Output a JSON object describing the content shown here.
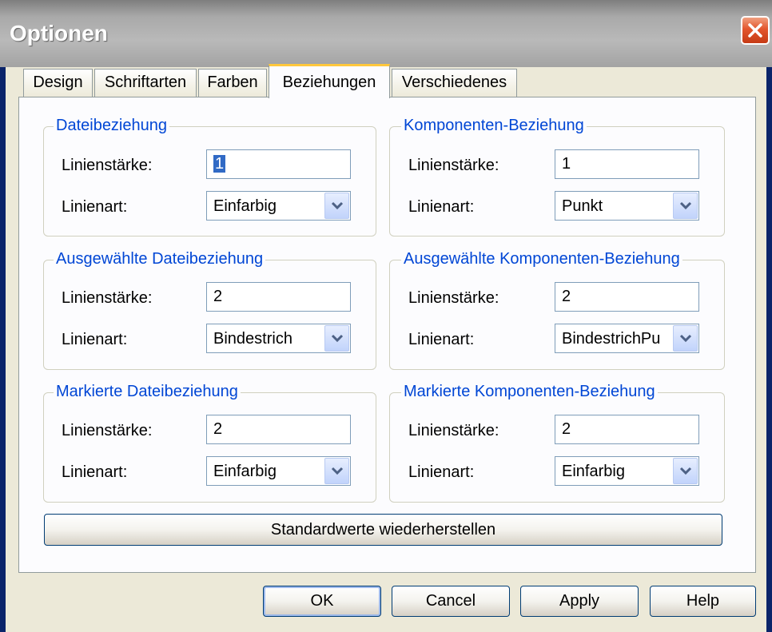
{
  "window": {
    "title": "Optionen"
  },
  "tabs": [
    {
      "label": "Design"
    },
    {
      "label": "Schriftarten"
    },
    {
      "label": "Farben"
    },
    {
      "label": "Beziehungen"
    },
    {
      "label": "Verschiedenes"
    }
  ],
  "active_tab": "Beziehungen",
  "groups": [
    {
      "title": "Dateibeziehung",
      "width_label": "Linienstärke:",
      "width_value": "1",
      "style_label": "Linienart:",
      "style_value": "Einfarbig"
    },
    {
      "title": "Komponenten-Beziehung",
      "width_label": "Linienstärke:",
      "width_value": "1",
      "style_label": "Linienart:",
      "style_value": "Punkt"
    },
    {
      "title": "Ausgewählte Dateibeziehung",
      "width_label": "Linienstärke:",
      "width_value": "2",
      "style_label": "Linienart:",
      "style_value": "Bindestrich"
    },
    {
      "title": "Ausgewählte Komponenten-Beziehung",
      "width_label": "Linienstärke:",
      "width_value": "2",
      "style_label": "Linienart:",
      "style_value": "BindestrichPu"
    },
    {
      "title": "Markierte Dateibeziehung",
      "width_label": "Linienstärke:",
      "width_value": "2",
      "style_label": "Linienart:",
      "style_value": "Einfarbig"
    },
    {
      "title": "Markierte Komponenten-Beziehung",
      "width_label": "Linienstärke:",
      "width_value": "2",
      "style_label": "Linienart:",
      "style_value": "Einfarbig"
    }
  ],
  "restore_button": "Standardwerte wiederherstellen",
  "buttons": {
    "ok": "OK",
    "cancel": "Cancel",
    "apply": "Apply",
    "help": "Help"
  },
  "icons": {
    "close": "close-icon",
    "dropdown": "chevron-down-icon"
  },
  "colors": {
    "group_title": "#0046d5",
    "active_tab_highlight": "#ffc83c",
    "close_button": "#e3562d"
  }
}
